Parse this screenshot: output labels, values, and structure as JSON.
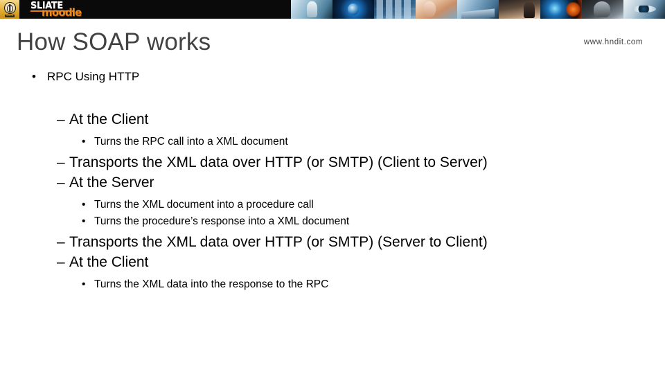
{
  "banner": {
    "crest_label": "SLIATE",
    "wordmark_primary": "SLIATE",
    "wordmark_secondary": "moodle",
    "background_color": "#0a0a0a",
    "crest_box_color": "#e8b63c",
    "wordmark_secondary_color": "#f08a1e",
    "collage_tiles": [
      "robot-figure-image",
      "blue-globe-eye-image",
      "cloud-network-screens-image",
      "people-collaboration-image",
      "hands-on-keyboard-image",
      "classroom-students-image",
      "globe-flare-image",
      "humanoid-head-circuit-image",
      "human-eye-closeup-image"
    ]
  },
  "header": {
    "title": "How SOAP works",
    "title_color": "#424242",
    "watermark": "www.hndit.com"
  },
  "content": {
    "level1": {
      "bullet": "•",
      "text": "RPC Using HTTP"
    },
    "items": [
      {
        "bullet": "–",
        "text": "At the Client",
        "children": [
          {
            "bullet": "•",
            "text": "Turns the RPC call into a XML document"
          }
        ]
      },
      {
        "bullet": "–",
        "text": "Transports the XML data over HTTP (or SMTP) (Client to Server)",
        "children": []
      },
      {
        "bullet": "–",
        "text": "At the Server",
        "children": [
          {
            "bullet": "•",
            "text": "Turns the XML document into a procedure call"
          },
          {
            "bullet": "•",
            "text": "Turns the procedure’s response into a XML document"
          }
        ]
      },
      {
        "bullet": "–",
        "text": "Transports the XML data over HTTP (or SMTP) (Server to Client)",
        "children": []
      },
      {
        "bullet": "–",
        "text": "At the Client",
        "children": [
          {
            "bullet": "•",
            "text": "Turns the XML data into the response to the RPC"
          }
        ]
      }
    ]
  }
}
